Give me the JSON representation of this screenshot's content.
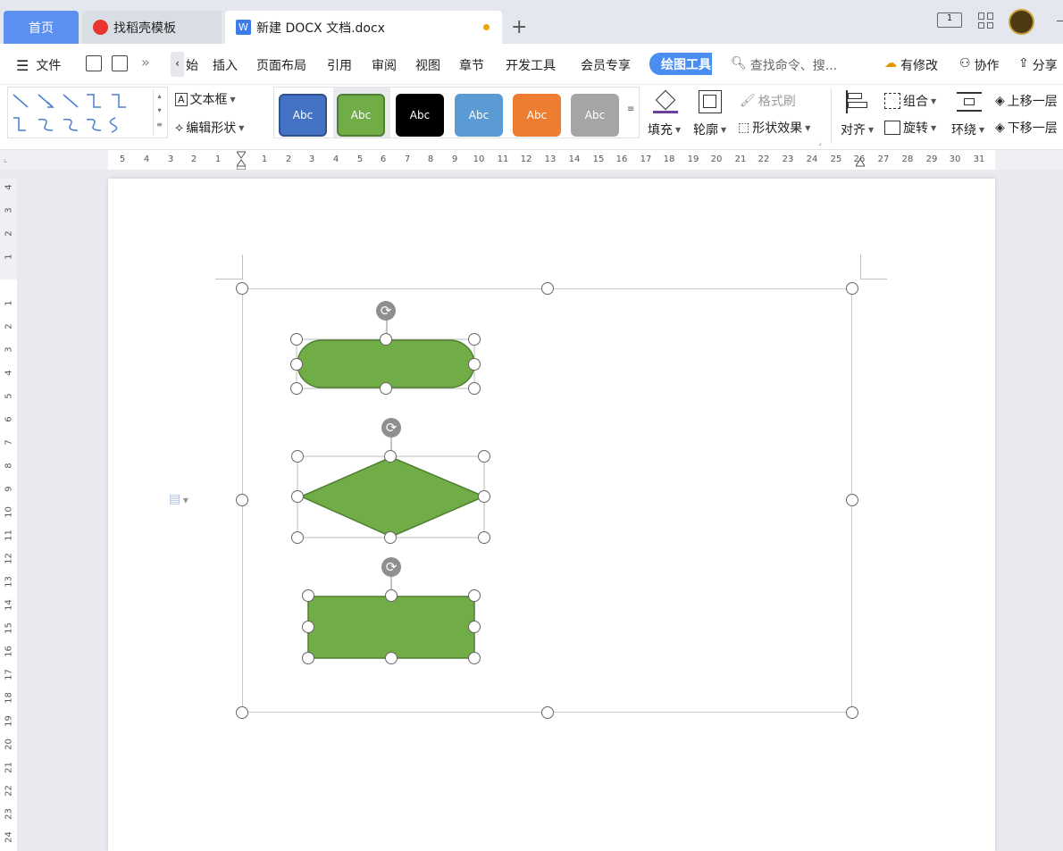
{
  "tabs": {
    "home": "首页",
    "template": "找稻壳模板",
    "document": "新建 DOCX 文档.docx",
    "add": "+"
  },
  "menu": {
    "file": "文件",
    "more": "»",
    "start_fragment": "始",
    "items": [
      "插入",
      "页面布局",
      "引用",
      "审阅",
      "视图",
      "章节",
      "开发工具",
      "会员专享"
    ],
    "drawing_tools": "绘图工具",
    "search": "查找命令、搜...",
    "changes": "有修改",
    "collab": "协作",
    "share": "分享"
  },
  "toolbar": {
    "text_box": "文本框",
    "edit_shape": "编辑形状",
    "style_label": "Abc",
    "style_colors": [
      "#4472c4",
      "#70ad47",
      "#000000",
      "#5b9bd5",
      "#ed7d31",
      "#a5a5a5"
    ],
    "fill": "填充",
    "outline": "轮廓",
    "format_painter": "格式刷",
    "shape_effects": "形状效果",
    "align": "对齐",
    "group": "组合",
    "rotate": "旋转",
    "wrap": "环绕",
    "bring_forward": "上移一层",
    "send_backward": "下移一层"
  },
  "ruler": {
    "h": [
      "5",
      "4",
      "3",
      "2",
      "1",
      "1",
      "2",
      "3",
      "4",
      "5",
      "6",
      "7",
      "8",
      "9",
      "10",
      "11",
      "12",
      "13",
      "14",
      "15",
      "16",
      "17",
      "18",
      "19",
      "20",
      "21",
      "22",
      "23",
      "24",
      "25",
      "26",
      "27",
      "28",
      "29",
      "30",
      "31"
    ],
    "v": [
      "4",
      "3",
      "2",
      "1",
      "1",
      "2",
      "3",
      "4",
      "5",
      "6",
      "7",
      "8",
      "9",
      "10",
      "11",
      "12",
      "13",
      "14",
      "15",
      "16",
      "17",
      "18",
      "19",
      "20",
      "21",
      "22",
      "23",
      "24"
    ]
  },
  "shape_fill": "#70ad47",
  "shape_stroke": "#507e32"
}
